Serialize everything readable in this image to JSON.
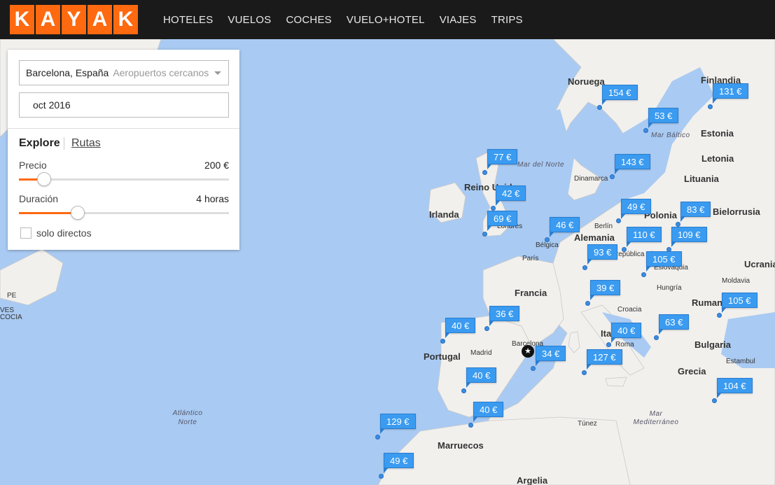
{
  "header": {
    "logo_letters": [
      "K",
      "A",
      "Y",
      "A",
      "K"
    ],
    "nav": [
      "HOTELES",
      "VUELOS",
      "COCHES",
      "VUELO+HOTEL",
      "VIAJES",
      "TRIPS"
    ]
  },
  "panel": {
    "origin_value": "Barcelona, España",
    "origin_placeholder": "Aeropuertos cercanos",
    "date_value": "oct 2016",
    "tab_explore": "Explore",
    "tab_routes": "Rutas",
    "price_label": "Precio",
    "price_value": "200 €",
    "price_fraction": 0.12,
    "duration_label": "Duración",
    "duration_value": "4 horas",
    "duration_fraction": 0.28,
    "direct_label": "solo directos",
    "direct_checked": false
  },
  "map": {
    "countries": [
      "Noruega",
      "Finlandia",
      "Estonia",
      "Letonia",
      "Lituania",
      "Bielorrusia",
      "Reino Unido",
      "Irlanda",
      "Polonia",
      "Alemania",
      "Bélgica",
      "Francia",
      "Portugal",
      "Italia",
      "Croacia",
      "Hungría",
      "Rumania",
      "Bulgaria",
      "Grecia",
      "Eslovaquia",
      "República Checa",
      "Moldavia",
      "Ucrania",
      "Marruecos",
      "Argelia",
      "Túnez"
    ],
    "cities": [
      "Berlín",
      "París",
      "Madrid",
      "Barcelona",
      "Roma",
      "Estambul",
      "Dinamarca",
      "Londres"
    ],
    "seas": [
      "Mar del Norte",
      "Mar Báltico",
      "Atlántico Norte",
      "Mar Mediterráneo"
    ],
    "prices": [
      "154 €",
      "131 €",
      "53 €",
      "77 €",
      "143 €",
      "42 €",
      "49 €",
      "83 €",
      "69 €",
      "46 €",
      "110 €",
      "109 €",
      "93 €",
      "105 €",
      "39 €",
      "36 €",
      "40 €",
      "40 €",
      "63 €",
      "105 €",
      "34 €",
      "127 €",
      "40 €",
      "40 €",
      "104 €",
      "129 €",
      "49 €"
    ],
    "left_edge_text": [
      "PE",
      "VES",
      "COCIA"
    ]
  },
  "colors": {
    "accent": "#ff690f",
    "price_bubble": "#3a9bf0",
    "water": "#a9caf2",
    "land": "#f1f0ed"
  }
}
